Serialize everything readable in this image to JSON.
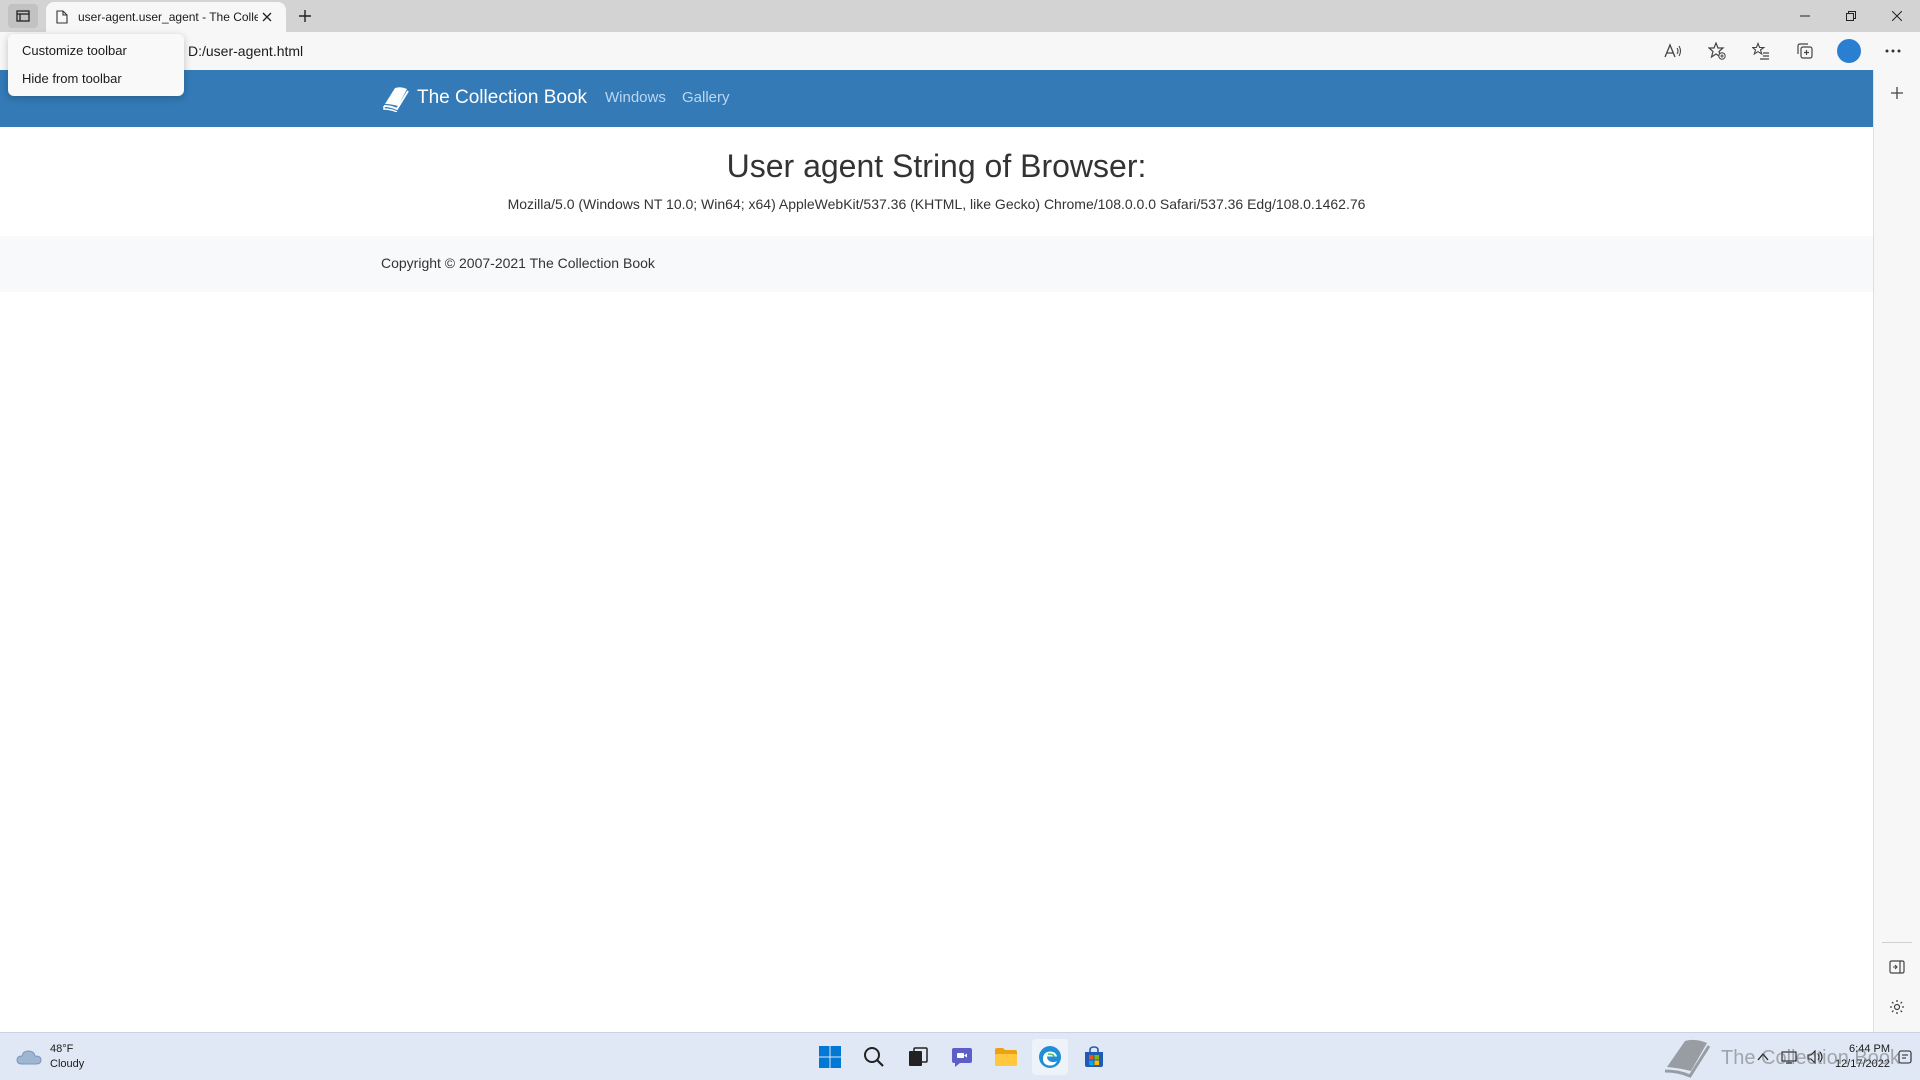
{
  "browser": {
    "tab_title": "user-agent.user_agent - The Collection Book",
    "address": "D:/user-agent.html"
  },
  "context_menu": {
    "items": [
      {
        "label": "Customize toolbar"
      },
      {
        "label": "Hide from toolbar"
      }
    ]
  },
  "site": {
    "brand": "The Collection Book",
    "nav": [
      {
        "label": "Windows"
      },
      {
        "label": "Gallery"
      }
    ],
    "heading": "User agent String of Browser:",
    "user_agent": "Mozilla/5.0 (Windows NT 10.0; Win64; x64) AppleWebKit/537.36 (KHTML, like Gecko) Chrome/108.0.0.0 Safari/537.36 Edg/108.0.1462.76",
    "footer": "Copyright © 2007-2021 The Collection Book"
  },
  "taskbar": {
    "weather_temp": "48°F",
    "weather_cond": "Cloudy",
    "time": "6:44 PM",
    "date": "12/17/2022",
    "watermark": "The Collection Book"
  },
  "colors": {
    "navbar": "#337ab7",
    "accent": "#0078d4"
  }
}
